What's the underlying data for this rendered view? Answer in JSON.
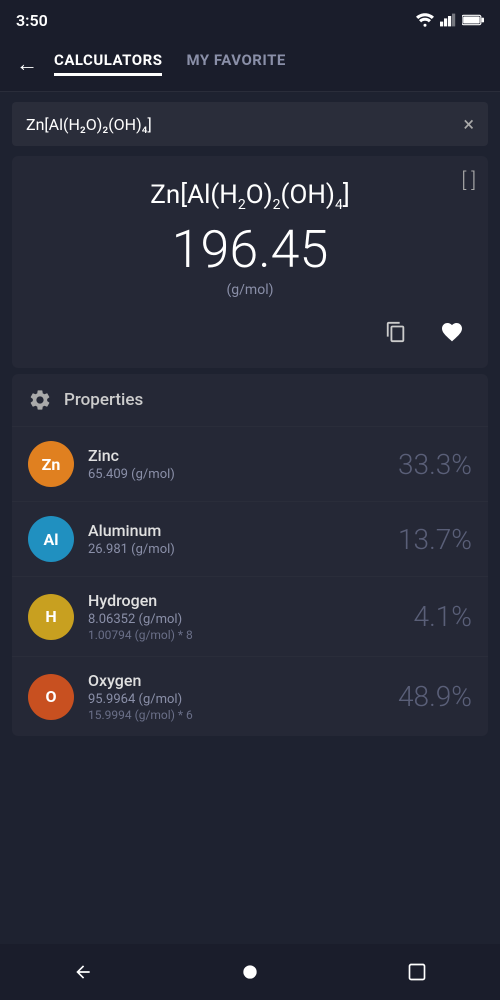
{
  "status_bar": {
    "time": "3:50"
  },
  "nav": {
    "back_label": "←",
    "tab_calculators": "CALCULATORS",
    "tab_favorite": "MY FAVORITE"
  },
  "search": {
    "value": "Zn[Al(H₂O)₂(OH)₄]",
    "clear_label": "×"
  },
  "formula_card": {
    "formula_text": "Zn[Al(H₂O)₂(OH)₄]",
    "molar_mass": "196.45",
    "unit": "(g/mol)",
    "bracket_label": "[ ]"
  },
  "properties": {
    "title": "Properties"
  },
  "elements": [
    {
      "symbol": "Zn",
      "name": "Zinc",
      "mass": "65.409 (g/mol)",
      "detail": "",
      "percent": "33.3%",
      "color": "#e08020"
    },
    {
      "symbol": "Al",
      "name": "Aluminum",
      "mass": "26.981 (g/mol)",
      "detail": "",
      "percent": "13.7%",
      "color": "#2090c0"
    },
    {
      "symbol": "H",
      "name": "Hydrogen",
      "mass": "8.06352 (g/mol)",
      "detail": "1.00794 (g/mol) * 8",
      "percent": "4.1%",
      "color": "#c8a020"
    },
    {
      "symbol": "O",
      "name": "Oxygen",
      "mass": "95.9964 (g/mol)",
      "detail": "15.9994 (g/mol) * 6",
      "percent": "48.9%",
      "color": "#c85020"
    }
  ]
}
